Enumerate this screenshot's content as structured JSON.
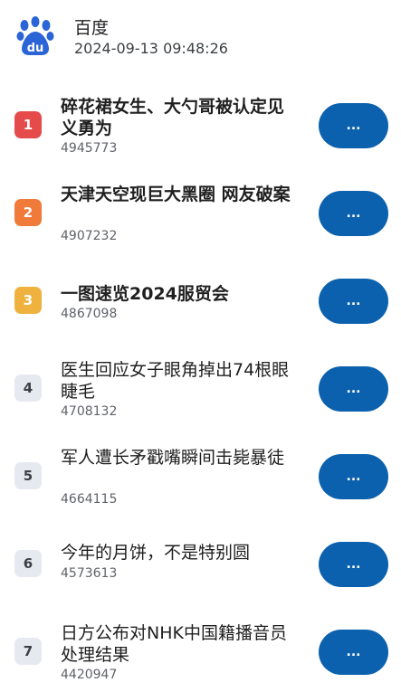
{
  "header": {
    "app_name": "百度",
    "logo_text": "du",
    "timestamp": "2024-09-13 09:48:26"
  },
  "colors": {
    "rank_1": "#e54b4b",
    "rank_2": "#f07a3a",
    "rank_3": "#f0b23f",
    "rank_normal": "#e6e9ef",
    "button": "#0b61ad",
    "logo": "#2b64d6"
  },
  "items": [
    {
      "rank": "1",
      "title": "碎花裙女生、大勺哥被认定见义勇为",
      "count": "4945773",
      "button_label": "..."
    },
    {
      "rank": "2",
      "title": "天津天空现巨大黑圈 网友破案",
      "count": "4907232",
      "button_label": "..."
    },
    {
      "rank": "3",
      "title": "一图速览2024服贸会",
      "count": "4867098",
      "button_label": "..."
    },
    {
      "rank": "4",
      "title": "医生回应女子眼角掉出74根眼睫毛",
      "count": "4708132",
      "button_label": "..."
    },
    {
      "rank": "5",
      "title": "军人遭长矛戳嘴瞬间击毙暴徒",
      "count": "4664115",
      "button_label": "..."
    },
    {
      "rank": "6",
      "title": "今年的月饼，不是特别圆",
      "count": "4573613",
      "button_label": "..."
    },
    {
      "rank": "7",
      "title": "日方公布对NHK中国籍播音员处理结果",
      "count": "4420947",
      "button_label": "..."
    }
  ]
}
